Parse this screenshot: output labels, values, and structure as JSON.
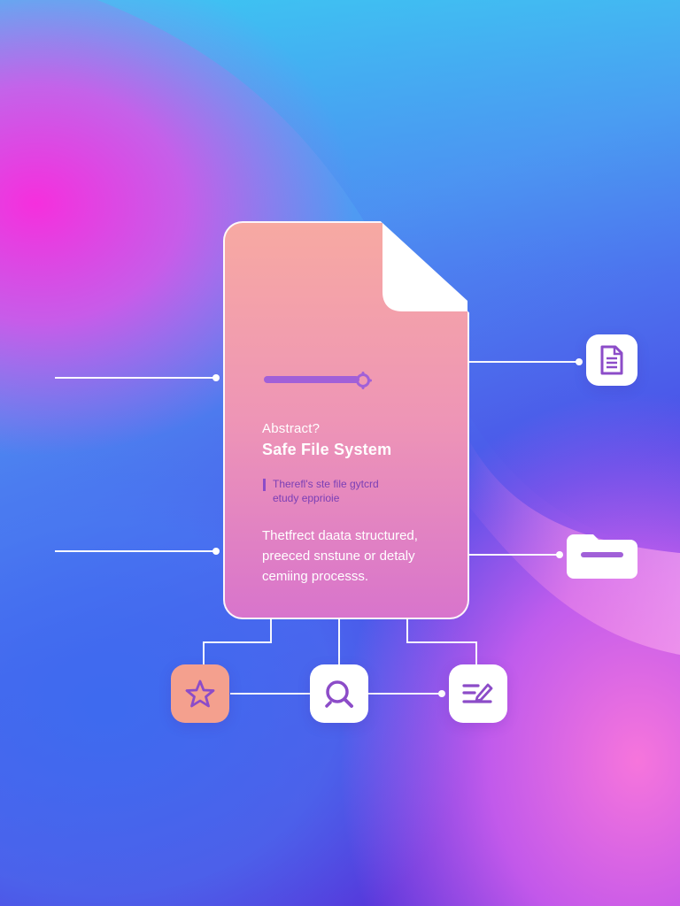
{
  "card": {
    "title_small": "Abstract?",
    "title_large": "Safe File System",
    "quote_line1": "Therefl's ste file gytcrd",
    "quote_line2": "etudy epprioie",
    "body_line1": "Thetfrect daata structured,",
    "body_line2": "preeced snstune or detaly",
    "body_line3": "cemiing processs."
  },
  "icons": {
    "document": "document-icon",
    "folder": "folder-icon",
    "star": "star-icon",
    "search": "search-icon",
    "edit": "edit-list-icon",
    "settings_knob": "gear-icon"
  },
  "colors": {
    "accent_purple": "#8c4cc8",
    "card_top": "#f7a9a2",
    "card_bottom": "#d874cc",
    "star_tile": "#f4a08e",
    "wire": "#ffffff"
  }
}
